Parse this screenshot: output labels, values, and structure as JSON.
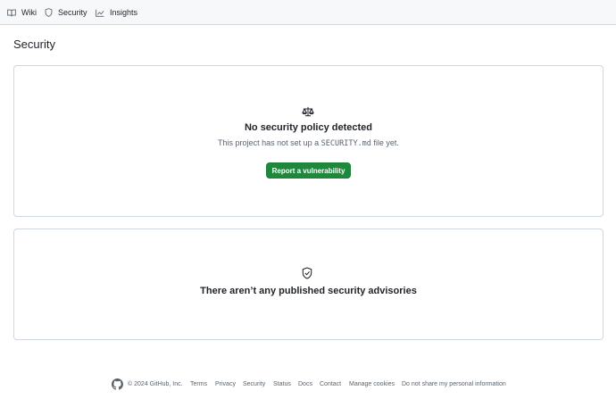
{
  "nav": {
    "items": [
      {
        "label": "Wiki",
        "icon": "book-icon"
      },
      {
        "label": "Security",
        "icon": "shield-icon"
      },
      {
        "label": "Insights",
        "icon": "graph-icon"
      }
    ]
  },
  "page": {
    "title": "Security"
  },
  "policy": {
    "icon": "law-icon",
    "title": "No security policy detected",
    "desc_before": "This project has not set up a ",
    "desc_code": "SECURITY.md",
    "desc_after": " file yet.",
    "button_label": "Report a vulnerability",
    "button_color": "#1f883d"
  },
  "advisories": {
    "icon": "shield-check-icon",
    "title": "There aren’t any published security advisories"
  },
  "footer": {
    "copyright": "© 2024 GitHub, Inc.",
    "links": [
      "Terms",
      "Privacy",
      "Security",
      "Status",
      "Docs",
      "Contact",
      "Manage cookies",
      "Do not share my personal information"
    ]
  }
}
